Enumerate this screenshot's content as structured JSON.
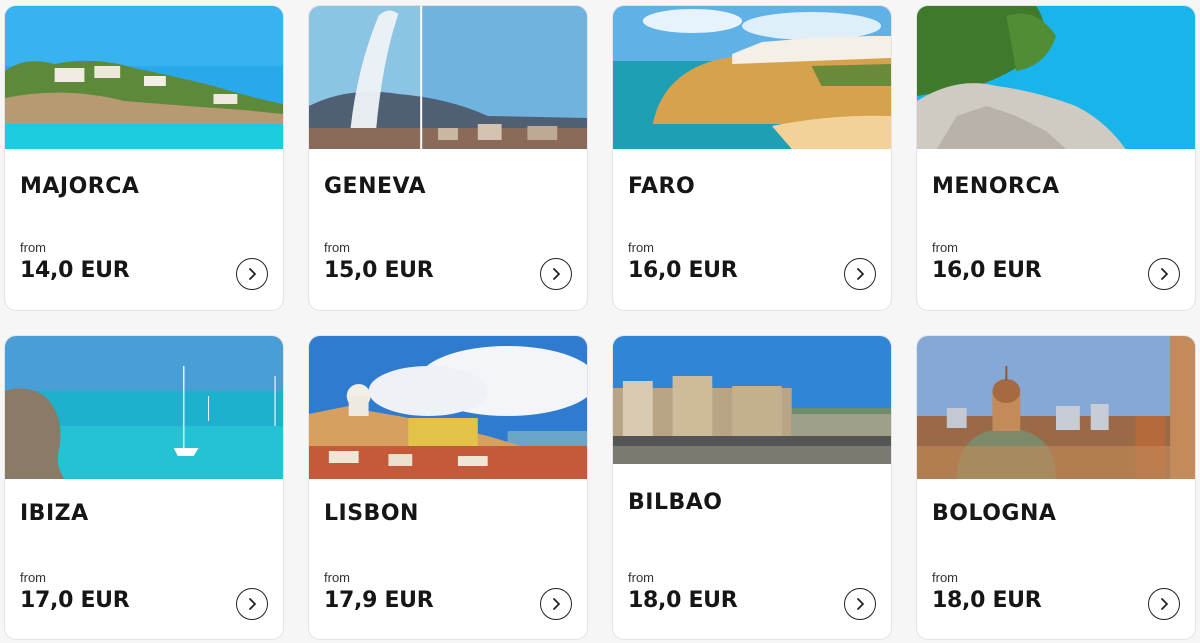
{
  "destinations": [
    {
      "city": "MAJORCA",
      "from_label": "from",
      "price": "14,0 EUR",
      "photo_icon": "beach-coast-photo",
      "colors": {
        "sky": "#2aa8ec",
        "sea": "#19c2dc",
        "land": "#5d8a3a"
      }
    },
    {
      "city": "GENEVA",
      "from_label": "from",
      "price": "15,0 EUR",
      "photo_icon": "fountain-lake-photo",
      "colors": {
        "sky": "#7fbde0",
        "sea": "#5f8aa8",
        "land": "#8a6b5a"
      }
    },
    {
      "city": "FARO",
      "from_label": "from",
      "price": "16,0 EUR",
      "photo_icon": "cliff-beach-photo",
      "colors": {
        "sky": "#5fb1e6",
        "sea": "#1f9fb4",
        "land": "#d7a24e"
      }
    },
    {
      "city": "MENORCA",
      "from_label": "from",
      "price": "16,0 EUR",
      "photo_icon": "rocky-coast-photo",
      "colors": {
        "sky": "#19b4ea",
        "sea": "#1aa0d4",
        "land": "#cfcac2"
      }
    },
    {
      "city": "IBIZA",
      "from_label": "from",
      "price": "17,0 EUR",
      "photo_icon": "sailboat-bay-photo",
      "colors": {
        "sky": "#4a9ed6",
        "sea": "#1eb0cc",
        "land": "#8a7a66"
      }
    },
    {
      "city": "LISBON",
      "from_label": "from",
      "price": "17,9 EUR",
      "photo_icon": "old-town-photo",
      "colors": {
        "sky": "#2f7bd0",
        "sea": "#6aa6c9",
        "land": "#d6a160"
      }
    },
    {
      "city": "BILBAO",
      "from_label": "from",
      "price": "18,0 EUR",
      "photo_icon": "river-buildings-photo",
      "colors": {
        "sky": "#2f86d6",
        "sea": "#6d8e6a",
        "land": "#b9a585"
      }
    },
    {
      "city": "BOLOGNA",
      "from_label": "from",
      "price": "18,0 EUR",
      "photo_icon": "dome-skyline-photo",
      "colors": {
        "sky": "#86a8d6",
        "sea": "#c48a5a",
        "land": "#9a6a48"
      }
    }
  ]
}
